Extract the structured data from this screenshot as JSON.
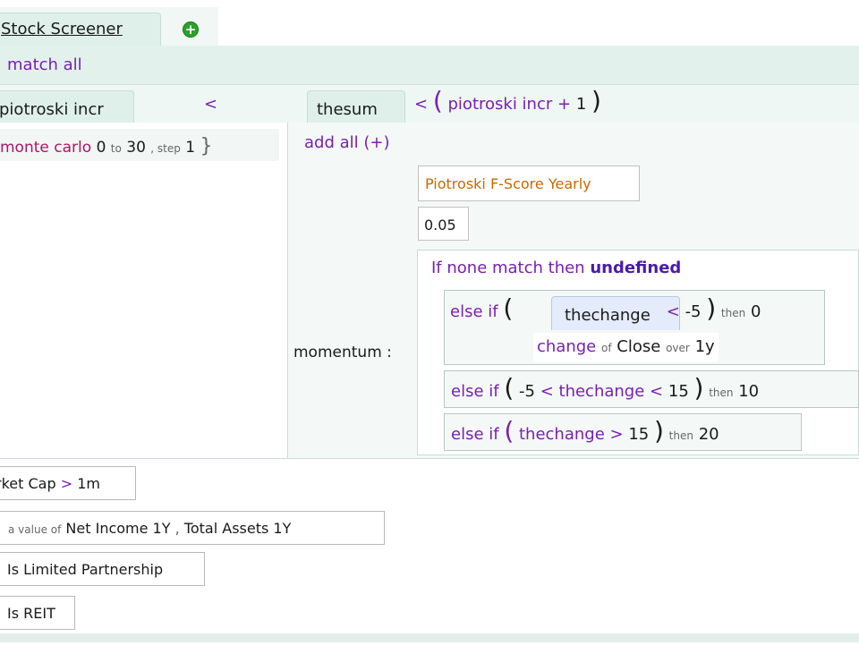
{
  "tabs": {
    "active": "Stock Screener",
    "add_icon": "plus-circle-icon"
  },
  "match": {
    "label": "match all"
  },
  "variables": {
    "left_name": "piotroski incr",
    "operator": "<",
    "thesum_name": "thesum",
    "expr": {
      "lt": "<",
      "open": "(",
      "var": "piotroski incr",
      "plus": "+",
      "num": "1",
      "close": ")"
    }
  },
  "monte_carlo": {
    "label": "monte carlo",
    "from": "0",
    "to_kw": "to",
    "to": "30",
    "step_kw": ", step",
    "step": "1",
    "brace": "}"
  },
  "thesum": {
    "add_all": "add all (+)",
    "item1": "Piotroski F-Score Yearly",
    "item2": "0.05",
    "momentum_label": "momentum :",
    "if_none": {
      "prefix": "If none match then",
      "value": "undefined"
    },
    "else_if_1": {
      "kw": "else if",
      "open": "(",
      "var": "thechange",
      "op": "<",
      "val": "-5",
      "close": ")",
      "then_kw": "then",
      "then_val": "0",
      "def": {
        "fn": "change",
        "of_kw": "of",
        "field": "Close",
        "over_kw": "over",
        "period": "1y"
      }
    },
    "else_if_2": {
      "kw": "else if",
      "open": "(",
      "lo": "-5",
      "op1": "<",
      "var": "thechange",
      "op2": "<",
      "hi": "15",
      "close": ")",
      "then_kw": "then",
      "then_val": "10"
    },
    "else_if_3": {
      "kw": "else if",
      "open": "(",
      "var": "thechange",
      "op": ">",
      "val": "15",
      "close": ")",
      "then_kw": "then",
      "then_val": "20"
    }
  },
  "conditions": {
    "mcap": {
      "field": "rket Cap",
      "op": ">",
      "val": "1m"
    },
    "ni": {
      "prefix": "a value of",
      "field1": "Net Income 1Y",
      "sep": ",",
      "field2": "Total Assets 1Y"
    },
    "lp": {
      "text": "Is Limited Partnership"
    },
    "reit": {
      "text": "Is REIT"
    }
  },
  "colors": {
    "purple": "#7a1fb0",
    "magenta": "#b0146a",
    "orange": "#c76a00",
    "tab_green": "#dff0ea",
    "add_green": "#28a428"
  }
}
